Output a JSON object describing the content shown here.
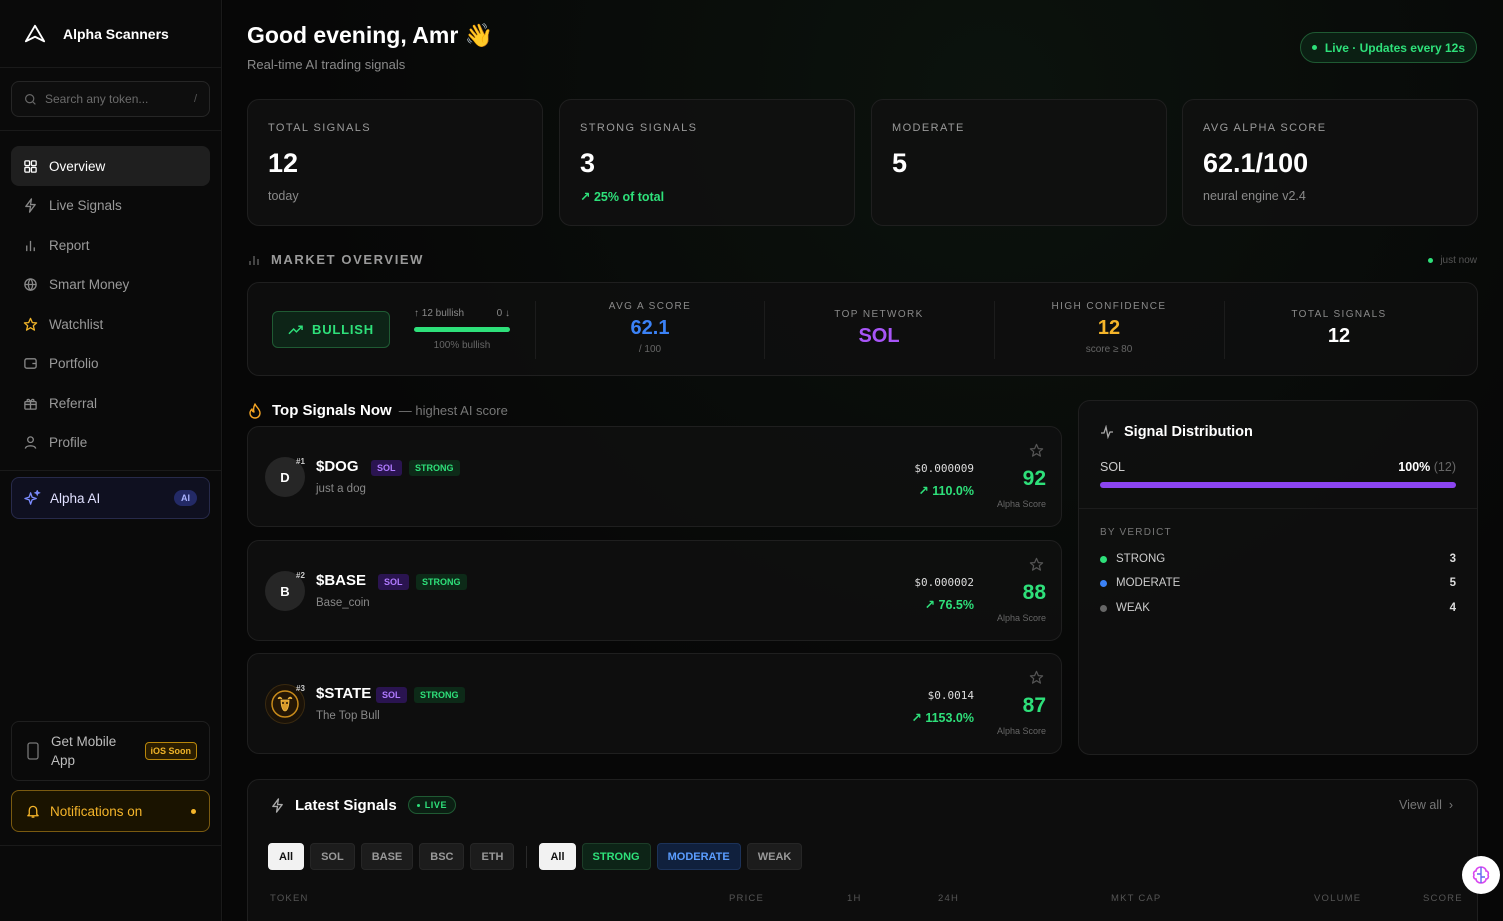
{
  "app": {
    "name": "Alpha Scanners"
  },
  "search": {
    "placeholder": "Search any token...",
    "shortcut": "/"
  },
  "nav": [
    {
      "label": "Overview",
      "icon": "grid-icon",
      "active": true
    },
    {
      "label": "Live Signals",
      "icon": "bolt-icon"
    },
    {
      "label": "Report",
      "icon": "bar-chart-icon"
    },
    {
      "label": "Smart Money",
      "icon": "globe-icon"
    },
    {
      "label": "Watchlist",
      "icon": "star-icon"
    },
    {
      "label": "Portfolio",
      "icon": "wallet-icon"
    },
    {
      "label": "Referral",
      "icon": "gift-icon"
    },
    {
      "label": "Profile",
      "icon": "user-icon"
    }
  ],
  "alpha_ai": {
    "label": "Alpha AI",
    "badge": "AI"
  },
  "mobile": {
    "label": "Get Mobile App",
    "badge": "iOS Soon"
  },
  "notifications": {
    "label": "Notifications on"
  },
  "header": {
    "greeting": "Good evening, Amr",
    "wave": "👋",
    "subtitle": "Real-time AI trading signals",
    "live": "Live · Updates every 12s"
  },
  "stats": [
    {
      "label": "TOTAL SIGNALS",
      "value": "12",
      "sub": "today"
    },
    {
      "label": "STRONG SIGNALS",
      "value": "3",
      "sub": "↗ 25% of total"
    },
    {
      "label": "MODERATE",
      "value": "5",
      "sub": ""
    },
    {
      "label": "AVG ALPHA SCORE",
      "value": "62.1/100",
      "sub": "neural engine v2.4"
    }
  ],
  "market": {
    "title": "MARKET OVERVIEW",
    "updated": "just now",
    "sentiment": "BULLISH",
    "bullish_count": "↑ 12 bullish",
    "bearish_count": "0 ↓",
    "bullish_fraction": 1.0,
    "bullish_pct": "100% bullish",
    "avg_score_label": "AVG A SCORE",
    "avg_score": "62.1",
    "avg_score_sub": "/ 100",
    "top_network_label": "TOP NETWORK",
    "top_network": "SOL",
    "high_conf_label": "HIGH CONFIDENCE",
    "high_conf": "12",
    "high_conf_sub": "score ≥ 80",
    "total_label": "TOTAL SIGNALS",
    "total": "12",
    "colors": {
      "avg": "#3b82f6",
      "network": "#a855f7",
      "high": "#f5b52a"
    }
  },
  "top_signals": {
    "title": "Top Signals Now",
    "sub": "— highest AI score",
    "items": [
      {
        "rank": "#1",
        "avatar": "D",
        "symbol": "$DOG",
        "chain": "SOL",
        "verdict": "STRONG",
        "name": "just a dog",
        "price": "$0.000009",
        "change": "↗ 110.0%",
        "score": "92",
        "score_label": "Alpha Score"
      },
      {
        "rank": "#2",
        "avatar": "B",
        "symbol": "$BASE",
        "chain": "SOL",
        "verdict": "STRONG",
        "name": "Base_coin",
        "price": "$0.000002",
        "change": "↗ 76.5%",
        "score": "88",
        "score_label": "Alpha Score"
      },
      {
        "rank": "#3",
        "avatar": "",
        "symbol": "$STATE",
        "chain": "SOL",
        "verdict": "STRONG",
        "name": "The Top Bull",
        "price": "$0.0014",
        "change": "↗ 1153.0%",
        "score": "87",
        "score_label": "Alpha Score"
      }
    ]
  },
  "distribution": {
    "title": "Signal Distribution",
    "chain": "SOL",
    "pct": "100%",
    "count": "(12)",
    "fraction": 1.0,
    "verdict_title": "BY VERDICT",
    "verdicts": [
      {
        "label": "STRONG",
        "count": "3",
        "color": "#2ee07a"
      },
      {
        "label": "MODERATE",
        "count": "5",
        "color": "#3b82f6"
      },
      {
        "label": "WEAK",
        "count": "4",
        "color": "#666666"
      }
    ]
  },
  "latest": {
    "title": "Latest Signals",
    "live": "LIVE",
    "view_all": "View all",
    "chain_filters": [
      "All",
      "SOL",
      "BASE",
      "BSC",
      "ETH"
    ],
    "verdict_filters": [
      "All",
      "STRONG",
      "MODERATE",
      "WEAK"
    ],
    "columns": [
      "TOKEN",
      "PRICE",
      "1H",
      "24H",
      "MKT CAP",
      "VOLUME",
      "SCORE"
    ]
  }
}
